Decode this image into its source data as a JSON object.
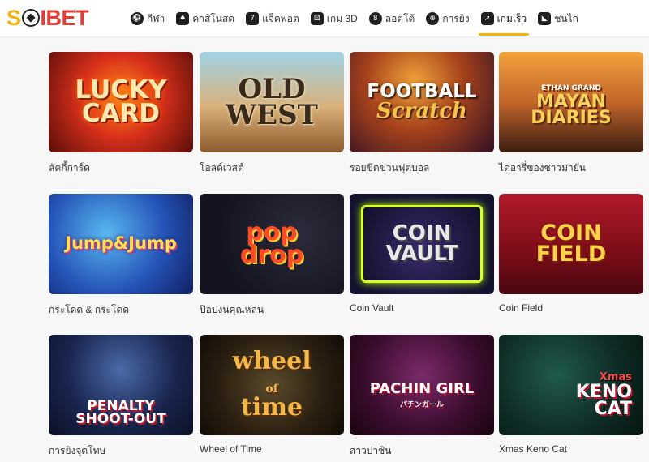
{
  "brand": {
    "logo_prefix": "S",
    "logo_suffix": "IBET"
  },
  "nav": [
    {
      "label": "กีฬา",
      "icon": "soccer-ball-icon"
    },
    {
      "label": "คาสิโนสด",
      "icon": "playing-card-icon"
    },
    {
      "label": "แจ็คพอต",
      "icon": "slot-777-icon"
    },
    {
      "label": "เกม 3D",
      "icon": "dice-icon"
    },
    {
      "label": "ลอตโต้",
      "icon": "lotto-ball-icon"
    },
    {
      "label": "การยิง",
      "icon": "crosshair-icon"
    },
    {
      "label": "เกมเร็ว",
      "icon": "rocket-icon",
      "active": true
    },
    {
      "label": "ชนไก่",
      "icon": "rooster-icon"
    }
  ],
  "games": [
    {
      "name": "ลัคกี้การ์ด",
      "art_lines": [
        "LUCKY",
        "CARD"
      ]
    },
    {
      "name": "โอลด์เวสต์",
      "art_lines": [
        "OLD",
        "WEST"
      ]
    },
    {
      "name": "รอยขีดข่วนฟุตบอล",
      "art_lines": [
        "FOOTBALL",
        "Scratch"
      ]
    },
    {
      "name": "ไดอารี่ของชาวมายัน",
      "art_lines": [
        "ETHAN GRAND",
        "MAYAN",
        "DIARIES"
      ]
    },
    {
      "name": "กระโดด & กระโดด",
      "art_lines": [
        "Jump&Jump"
      ]
    },
    {
      "name": "ป๊อปงนคุณหล่น",
      "art_lines": [
        "pop",
        "drop"
      ]
    },
    {
      "name": "Coin Vault",
      "art_lines": [
        "COIN",
        "VAULT"
      ]
    },
    {
      "name": "Coin Field",
      "art_lines": [
        "COIN",
        "FIELD"
      ]
    },
    {
      "name": "การยิงจุดโทษ",
      "art_lines": [
        "PENALTY",
        "SHOOT-OUT"
      ]
    },
    {
      "name": "Wheel of Time",
      "art_lines": [
        "wheel",
        "of",
        "time"
      ]
    },
    {
      "name": "สาวปาชิน",
      "art_lines": [
        "PACHIN GIRL",
        "パチンガール"
      ]
    },
    {
      "name": "Xmas Keno Cat",
      "art_lines": [
        "Xmas",
        "KENO",
        "CAT"
      ]
    }
  ]
}
